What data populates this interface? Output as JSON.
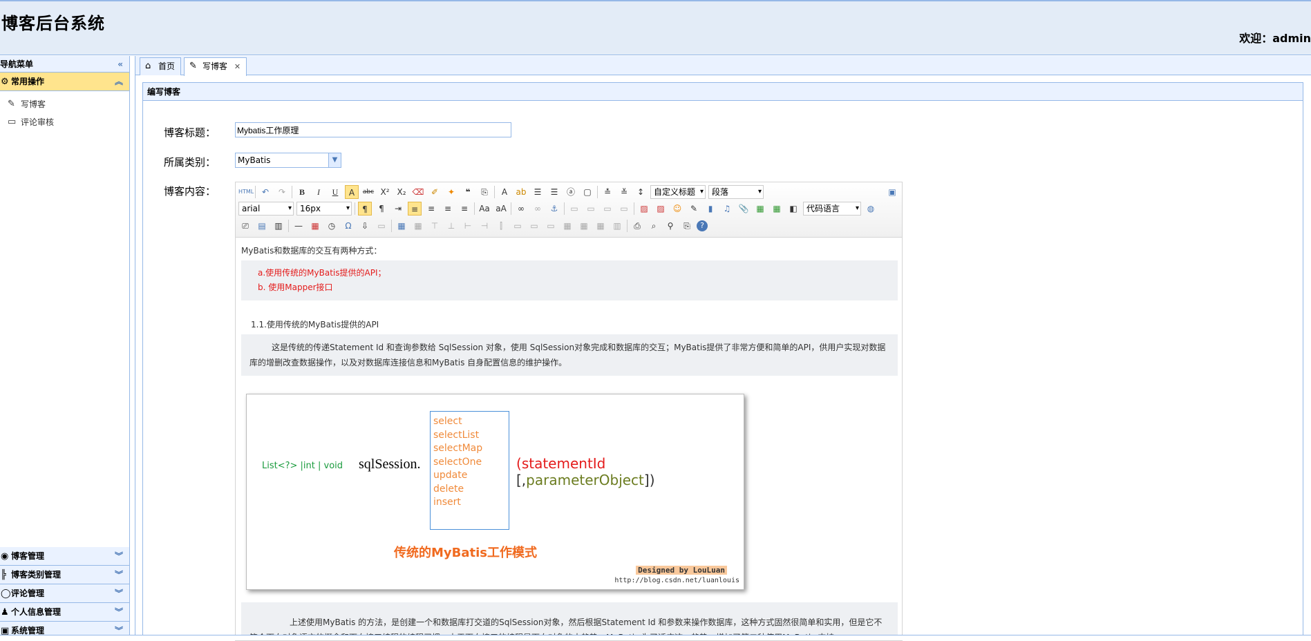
{
  "header": {
    "app_title": "博客后台系统",
    "welcome": "欢迎：admin"
  },
  "sidebar": {
    "title": "导航菜单",
    "active_panel": "常用操作",
    "items": [
      "写博客",
      "评论审核"
    ],
    "panels": [
      "博客管理",
      "博客类别管理",
      "评论管理",
      "个人信息管理",
      "系统管理"
    ]
  },
  "tabs": [
    {
      "label": "首页"
    },
    {
      "label": "写博客"
    }
  ],
  "panel_title": "编写博客",
  "form": {
    "title_label": "博客标题：",
    "title_value": "Mybatis工作原理",
    "category_label": "所属类别：",
    "category_value": "MyBatis",
    "content_label": "博客内容："
  },
  "toolbar": {
    "font_family": "arial",
    "font_size": "16px",
    "heading": "自定义标题",
    "paragraph": "段落",
    "code_lang": "代码语言"
  },
  "doc": {
    "intro": "MyBatis和数据库的交互有两种方式：",
    "way_a": "a.使用传统的MyBatis提供的API；",
    "way_b": "b. 使用Mapper接口",
    "heading_1_1": "1.1.使用传统的MyBatis提供的API",
    "para1": "这是传统的传递Statement Id 和查询参数给 SqlSession 对象，使用 SqlSession对象完成和数据库的交互；MyBatis提供了非常方便和简单的API，供用户实现对数据库的增删改查数据操作，以及对数据库连接信息和MyBatis 自身配置信息的维护操作。",
    "para2": "上述使用MyBatis 的方法，是创建一个和数据库打交道的SqlSession对象，然后根据Statement Id 和参数来操作数据库，这种方式固然很简单和实用，但是它不符合面向对象语言的概念和面向接口编程的编程习惯。由于面向接口的编程是面向对象的大趋势，MyBatis 为了适应这一趋势，增加了第二种使用MyBatis 支持"
  },
  "figure": {
    "returns": "List<?> |int | void",
    "session": "sqlSession.",
    "methods": [
      "select",
      "selectList",
      "selectMap",
      "selectOne",
      "update",
      "delete",
      "insert"
    ],
    "args_open": "(",
    "statement_id": "statementId",
    "args_mid": " [,",
    "parameter_object": "parameterObject",
    "args_close": "])",
    "caption": "传统的MyBatis工作模式",
    "designed": "Designed by LouLuan",
    "url": "http://blog.csdn.net/luanlouis"
  },
  "colors": {
    "accent": "#95b8e7",
    "panel_bg": "#eaf2ff",
    "active_panel": "#ffe48d"
  }
}
